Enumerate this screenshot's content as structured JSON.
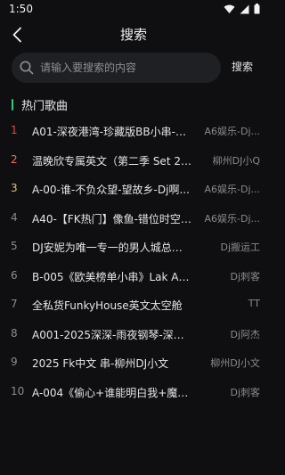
{
  "status_bar": {
    "time": "1:50"
  },
  "header": {
    "title": "搜索",
    "back_icon": "chevron-left-icon"
  },
  "search": {
    "placeholder": "请输入要搜索的内容",
    "value": "",
    "action_label": "搜索",
    "icon": "search-icon"
  },
  "section": {
    "title": "热门歌曲",
    "accent_color": "#35c97b"
  },
  "colors": {
    "rank_1": "#e24a4a",
    "rank_2": "#ef6a5a",
    "rank_3": "#e8c36a",
    "rank_default": "#8b8b90"
  },
  "songs": [
    {
      "rank": "1",
      "title": "A01-深夜港湾-珍藏版BB小串-Dj...",
      "artist": "A6娱乐-Dj..."
    },
    {
      "rank": "2",
      "title": "温晚欣专属英文（第二季 Set 20...",
      "artist": "柳州DJ小Q"
    },
    {
      "rank": "3",
      "title": "A-00-谁-不负众望-望故乡-Dj啊...",
      "artist": "A6娱乐-Dj..."
    },
    {
      "rank": "4",
      "title": "A40-【FK热门】像鱼-错位时空-...",
      "artist": "A6娱乐-Dj..."
    },
    {
      "rank": "5",
      "title": "DJ安妮为唯一专一的男人城总独...",
      "artist": "Dj搬运工"
    },
    {
      "rank": "6",
      "title": "B-005《欧美榜单小串》Lak A6...",
      "artist": "Dj刺客"
    },
    {
      "rank": "7",
      "title": "全私货FunkyHouse英文太空舱",
      "artist": "TT"
    },
    {
      "rank": "8",
      "title": "A001-2025深深-雨夜钢琴-深夜...",
      "artist": "Dj阿杰"
    },
    {
      "rank": "9",
      "title": "2025 Fk中文 串-柳州DJ小文",
      "artist": "柳州DJ小文"
    },
    {
      "rank": "10",
      "title": "A-004《偷心+谁能明白我+魔鬼...",
      "artist": "Dj刺客"
    }
  ]
}
